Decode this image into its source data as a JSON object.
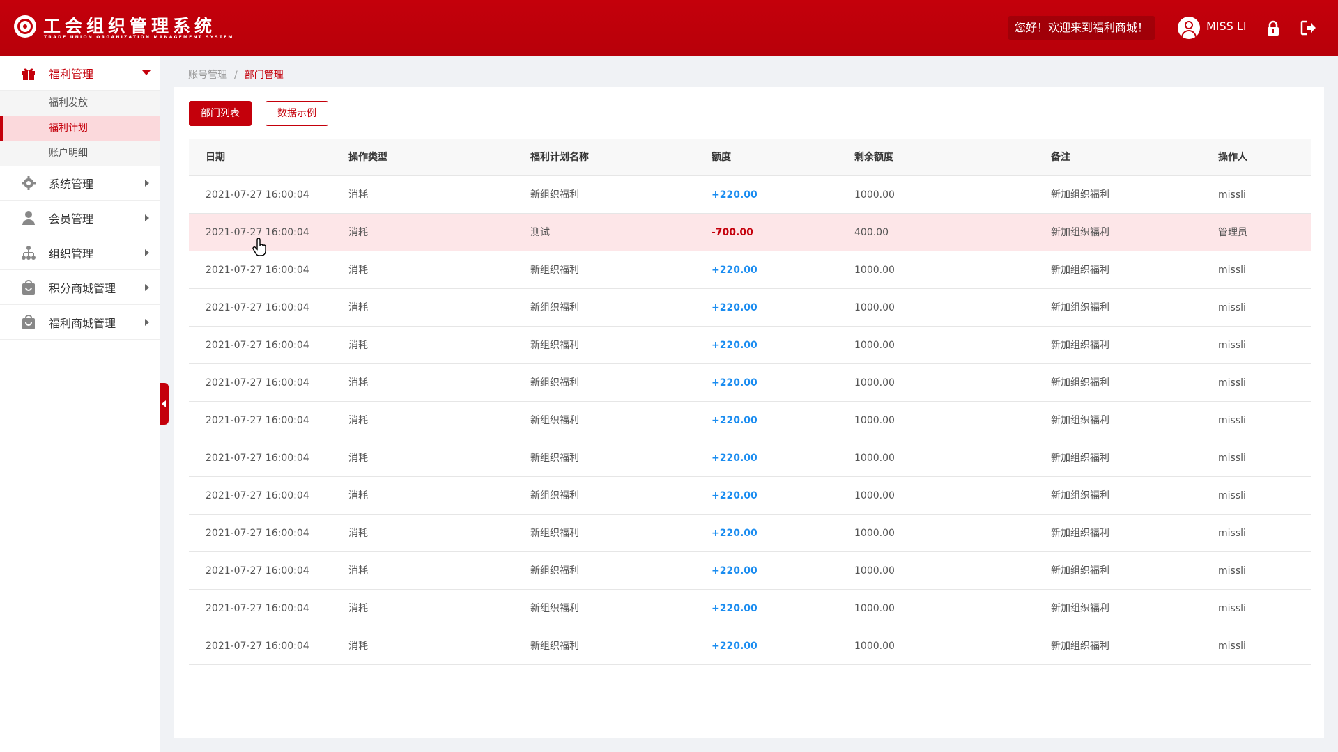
{
  "header": {
    "brand_title": "工会组织管理系统",
    "brand_subtitle": "TRADE UNION ORGANIZATION MANAGEMENT SYSTEM",
    "welcome": "您好！欢迎来到福利商城！",
    "username": "MISS LI",
    "icons": [
      "logo-icon",
      "avatar-icon",
      "lock-icon",
      "logout-icon"
    ]
  },
  "sidebar": {
    "menus": [
      {
        "label": "福利管理",
        "icon": "gift-icon",
        "open": true,
        "children": [
          {
            "label": "福利发放"
          },
          {
            "label": "福利计划",
            "active": true
          },
          {
            "label": "账户明细"
          }
        ]
      },
      {
        "label": "系统管理",
        "icon": "gear-icon"
      },
      {
        "label": "会员管理",
        "icon": "user-icon"
      },
      {
        "label": "组织管理",
        "icon": "org-icon"
      },
      {
        "label": "积分商城管理",
        "icon": "shop-icon"
      },
      {
        "label": "福利商城管理",
        "icon": "shop-icon"
      }
    ]
  },
  "breadcrumb": {
    "parent": "账号管理",
    "separator": "/",
    "current": "部门管理"
  },
  "toolbar": {
    "primary_label": "部门列表",
    "secondary_label": "数据示例"
  },
  "table": {
    "columns": [
      "日期",
      "操作类型",
      "福利计划名称",
      "额度",
      "剩余额度",
      "备注",
      "操作人"
    ],
    "rows": [
      [
        "2021-07-27  16:00:04",
        "消耗",
        "新组织福利",
        "+220.00",
        "1000.00",
        "新加组织福利",
        "missli"
      ],
      [
        "2021-07-27  16:00:04",
        "消耗",
        "测试",
        "-700.00",
        "400.00",
        "新加组织福利",
        "管理员"
      ],
      [
        "2021-07-27  16:00:04",
        "消耗",
        "新组织福利",
        "+220.00",
        "1000.00",
        "新加组织福利",
        "missli"
      ],
      [
        "2021-07-27  16:00:04",
        "消耗",
        "新组织福利",
        "+220.00",
        "1000.00",
        "新加组织福利",
        "missli"
      ],
      [
        "2021-07-27  16:00:04",
        "消耗",
        "新组织福利",
        "+220.00",
        "1000.00",
        "新加组织福利",
        "missli"
      ],
      [
        "2021-07-27  16:00:04",
        "消耗",
        "新组织福利",
        "+220.00",
        "1000.00",
        "新加组织福利",
        "missli"
      ],
      [
        "2021-07-27  16:00:04",
        "消耗",
        "新组织福利",
        "+220.00",
        "1000.00",
        "新加组织福利",
        "missli"
      ],
      [
        "2021-07-27  16:00:04",
        "消耗",
        "新组织福利",
        "+220.00",
        "1000.00",
        "新加组织福利",
        "missli"
      ],
      [
        "2021-07-27  16:00:04",
        "消耗",
        "新组织福利",
        "+220.00",
        "1000.00",
        "新加组织福利",
        "missli"
      ],
      [
        "2021-07-27  16:00:04",
        "消耗",
        "新组织福利",
        "+220.00",
        "1000.00",
        "新加组织福利",
        "missli"
      ],
      [
        "2021-07-27  16:00:04",
        "消耗",
        "新组织福利",
        "+220.00",
        "1000.00",
        "新加组织福利",
        "missli"
      ],
      [
        "2021-07-27  16:00:04",
        "消耗",
        "新组织福利",
        "+220.00",
        "1000.00",
        "新加组织福利",
        "missli"
      ],
      [
        "2021-07-27  16:00:04",
        "消耗",
        "新组织福利",
        "+220.00",
        "1000.00",
        "新加组织福利",
        "missli"
      ]
    ],
    "highlighted_row": 1
  },
  "colors": {
    "brand": "#c4000b",
    "positive_amount": "#1a8cf0",
    "negative_amount": "#c4000b",
    "highlight_row": "#fde6e8"
  }
}
